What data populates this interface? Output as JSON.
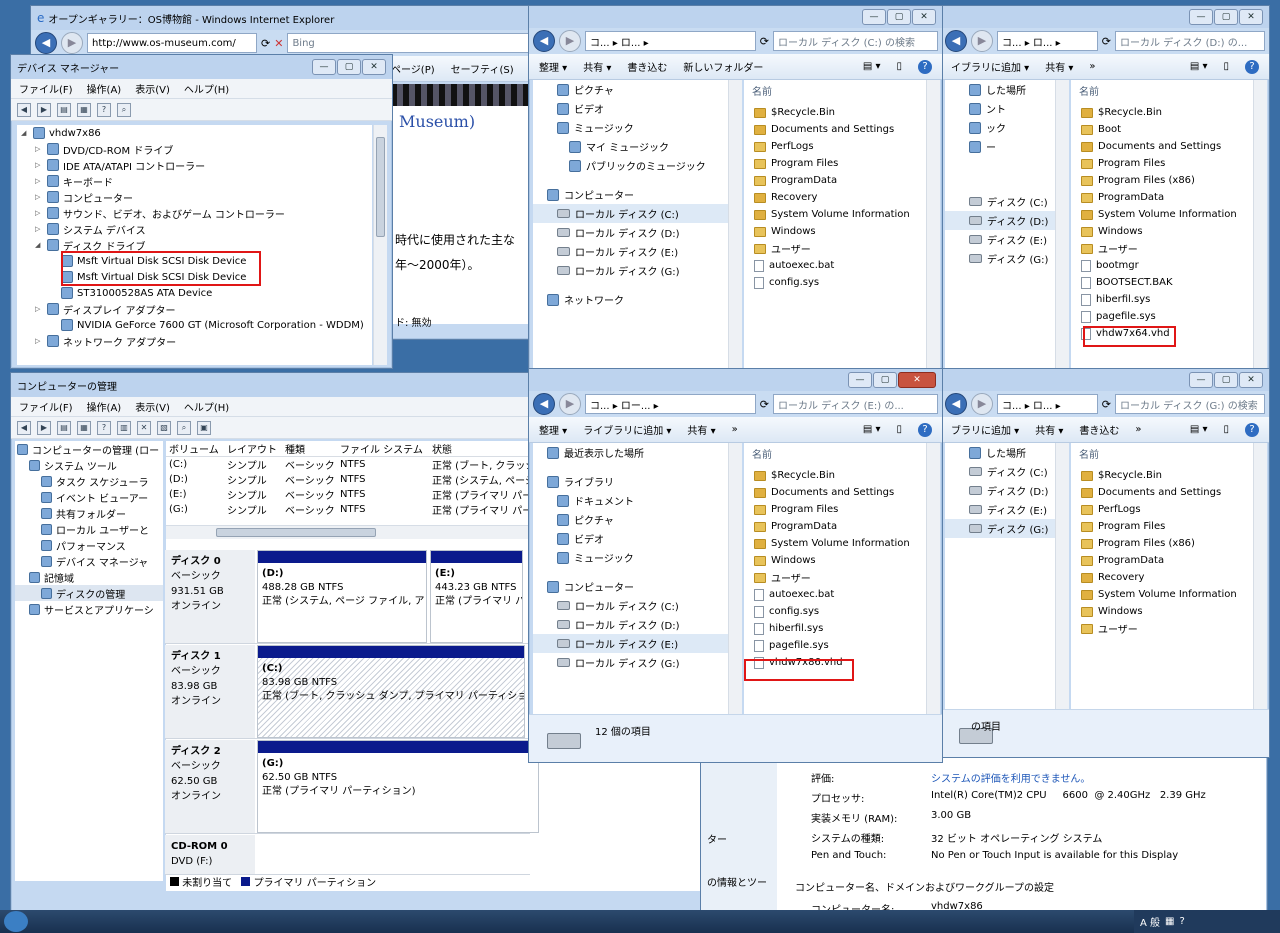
{
  "ie": {
    "title": "オープンギャラリー：OS博物館 - Windows Internet Explorer",
    "url": "http://www.os-museum.com/",
    "search": "Bing",
    "menu_page": "ページ(P)",
    "menu_safety": "セーフティ(S)",
    "heading_fragment": "Museum)",
    "text1": "時代に使用された主な",
    "text2": "年～2000年）。",
    "status_fragment": "ド: 無効"
  },
  "devmgr": {
    "title": "デバイス マネージャー",
    "menu": [
      "ファイル(F)",
      "操作(A)",
      "表示(V)",
      "ヘルプ(H)"
    ],
    "tree": [
      {
        "label": "vhdw7x86",
        "level": 0
      },
      {
        "label": "DVD/CD-ROM ドライブ",
        "level": 1
      },
      {
        "label": "IDE ATA/ATAPI コントローラー",
        "level": 1
      },
      {
        "label": "キーボード",
        "level": 1
      },
      {
        "label": "コンピューター",
        "level": 1
      },
      {
        "label": "サウンド、ビデオ、およびゲーム コントローラー",
        "level": 1
      },
      {
        "label": "システム デバイス",
        "level": 1
      },
      {
        "label": "ディスク ドライブ",
        "level": 1
      },
      {
        "label": "Msft Virtual Disk SCSI Disk Device",
        "level": 2
      },
      {
        "label": "Msft Virtual Disk SCSI Disk Device",
        "level": 2
      },
      {
        "label": "ST31000528AS ATA Device",
        "level": 2
      },
      {
        "label": "ディスプレイ アダプター",
        "level": 1
      },
      {
        "label": "NVIDIA GeForce 7600 GT (Microsoft Corporation - WDDM)",
        "level": 2
      },
      {
        "label": "ネットワーク アダプター",
        "level": 1
      }
    ]
  },
  "explorer_c": {
    "breadcrumb": "コ... ▸ ロ... ▸",
    "search_placeholder": "ローカル ディスク (C:) の検索",
    "cmd": [
      "整理 ▾",
      "共有 ▾",
      "書き込む",
      "新しいフォルダー"
    ],
    "nav": [
      "ピクチャ",
      "ビデオ",
      "ミュージック",
      "マイ ミュージック",
      "パブリックのミュージック",
      "コンピューター",
      "ローカル ディスク (C:)",
      "ローカル ディスク (D:)",
      "ローカル ディスク (E:)",
      "ローカル ディスク (G:)",
      "ネットワーク"
    ],
    "col": "名前",
    "items": [
      "$Recycle.Bin",
      "Documents and Settings",
      "PerfLogs",
      "Program Files",
      "ProgramData",
      "Recovery",
      "System Volume Information",
      "Windows",
      "ユーザー",
      "autoexec.bat",
      "config.sys"
    ]
  },
  "explorer_d": {
    "breadcrumb": "コ... ▸ ロ... ▸",
    "search_placeholder": "ローカル ディスク (D:) の...",
    "cmd": [
      "イブラリに追加 ▾",
      "共有 ▾",
      "»"
    ],
    "nav": [
      "した場所",
      "ント",
      "ック",
      "ー",
      "ディスク (C:)",
      "ディスク (D:)",
      "ディスク (E:)",
      "ディスク (G:)"
    ],
    "col": "名前",
    "items": [
      "$Recycle.Bin",
      "Boot",
      "Documents and Settings",
      "Program Files",
      "Program Files (x86)",
      "ProgramData",
      "System Volume Information",
      "Windows",
      "ユーザー",
      "bootmgr",
      "BOOTSECT.BAK",
      "hiberfil.sys",
      "pagefile.sys",
      "vhdw7x64.vhd"
    ]
  },
  "explorer_e": {
    "breadcrumb": "コ... ▸ ロー... ▸",
    "search_placeholder": "ローカル ディスク (E:) の...",
    "cmd": [
      "整理 ▾",
      "ライブラリに追加 ▾",
      "共有 ▾",
      "»"
    ],
    "nav": [
      "最近表示した場所",
      "ライブラリ",
      "ドキュメント",
      "ピクチャ",
      "ビデオ",
      "ミュージック",
      "コンピューター",
      "ローカル ディスク (C:)",
      "ローカル ディスク (D:)",
      "ローカル ディスク (E:)",
      "ローカル ディスク (G:)"
    ],
    "col": "名前",
    "items": [
      "$Recycle.Bin",
      "Documents and Settings",
      "Program Files",
      "ProgramData",
      "System Volume Information",
      "Windows",
      "ユーザー",
      "autoexec.bat",
      "config.sys",
      "hiberfil.sys",
      "pagefile.sys",
      "vhdw7x86.vhd"
    ],
    "status": "12 個の項目"
  },
  "explorer_g": {
    "breadcrumb": "コ... ▸ ロ... ▸",
    "search_placeholder": "ローカル ディスク (G:) の検索",
    "cmd": [
      "ブラリに追加 ▾",
      "共有 ▾",
      "書き込む",
      "»"
    ],
    "nav": [
      "した場所",
      "ディスク (C:)",
      "ディスク (D:)",
      "ディスク (E:)",
      "ディスク (G:)"
    ],
    "col": "名前",
    "items": [
      "$Recycle.Bin",
      "Documents and Settings",
      "PerfLogs",
      "Program Files",
      "Program Files (x86)",
      "ProgramData",
      "Recovery",
      "System Volume Information",
      "Windows",
      "ユーザー"
    ],
    "status": "の項目"
  },
  "compmgmt": {
    "title": "コンピューターの管理",
    "menu": [
      "ファイル(F)",
      "操作(A)",
      "表示(V)",
      "ヘルプ(H)"
    ],
    "tree": [
      {
        "label": "コンピューターの管理 (ロー",
        "level": 0
      },
      {
        "label": "システム ツール",
        "level": 1
      },
      {
        "label": "タスク スケジューラ",
        "level": 2
      },
      {
        "label": "イベント ビューアー",
        "level": 2
      },
      {
        "label": "共有フォルダー",
        "level": 2
      },
      {
        "label": "ローカル ユーザーと",
        "level": 2
      },
      {
        "label": "パフォーマンス",
        "level": 2
      },
      {
        "label": "デバイス マネージャ",
        "level": 2
      },
      {
        "label": "記憶域",
        "level": 1
      },
      {
        "label": "ディスクの管理",
        "level": 2
      },
      {
        "label": "サービスとアプリケーシ",
        "level": 1
      }
    ],
    "columns": [
      "ボリューム",
      "レイアウト",
      "種類",
      "ファイル システム",
      "状態"
    ],
    "volumes": [
      [
        "(C:)",
        "シンプル",
        "ベーシック",
        "NTFS",
        "正常 (ブート, クラッシ"
      ],
      [
        "(D:)",
        "シンプル",
        "ベーシック",
        "NTFS",
        "正常 (システム, ページ"
      ],
      [
        "(E:)",
        "シンプル",
        "ベーシック",
        "NTFS",
        "正常 (プライマリ パー"
      ],
      [
        "(G:)",
        "シンプル",
        "ベーシック",
        "NTFS",
        "正常 (プライマリ パー"
      ]
    ],
    "disks": [
      {
        "name": "ディスク 0",
        "type": "ベーシック",
        "size": "931.51 GB",
        "state": "オンライン",
        "parts": [
          {
            "label": "(D:)",
            "size": "488.28 GB NTFS",
            "status": "正常 (システム, ページ ファイル, ア"
          },
          {
            "label": "(E:)",
            "size": "443.23 GB NTFS",
            "status": "正常 (プライマリ パー"
          }
        ]
      },
      {
        "name": "ディスク 1",
        "type": "ベーシック",
        "size": "83.98 GB",
        "state": "オンライン",
        "parts": [
          {
            "label": "(C:)",
            "size": "83.98 GB NTFS",
            "status": "正常 (ブート, クラッシュ ダンプ, プライマリ パーティション"
          }
        ]
      },
      {
        "name": "ディスク 2",
        "type": "ベーシック",
        "size": "62.50 GB",
        "state": "オンライン",
        "parts": [
          {
            "label": "(G:)",
            "size": "62.50 GB NTFS",
            "status": "正常 (プライマリ パーティション)"
          }
        ]
      },
      {
        "name": "CD-ROM 0",
        "type": "DVD (F:)",
        "size": "",
        "state": "",
        "parts": []
      }
    ],
    "legend_unalloc": "未割り当て",
    "legend_primary": "プライマリ パーティション"
  },
  "sysinfo": {
    "rows": [
      {
        "k": "評価:",
        "v": "システムの評価を利用できません。"
      },
      {
        "k": "プロセッサ:",
        "v": "Intel(R) Core(TM)2 CPU     6600  @ 2.40GHz   2.39 GHz"
      },
      {
        "k": "実装メモリ (RAM):",
        "v": "3.00 GB"
      },
      {
        "k": "システムの種類:",
        "v": "32 ビット オペレーティング システム"
      },
      {
        "k": "Pen and Touch:",
        "v": "No Pen or Touch Input is available for this Display"
      }
    ],
    "section": "コンピューター名、ドメインおよびワークグループの設定",
    "cname_k": "コンピューター名:",
    "cname_v": "vhdw7x86",
    "side_a": "ター",
    "side_b": "の情報とツー"
  },
  "tray": {
    "ime": "A 般"
  }
}
